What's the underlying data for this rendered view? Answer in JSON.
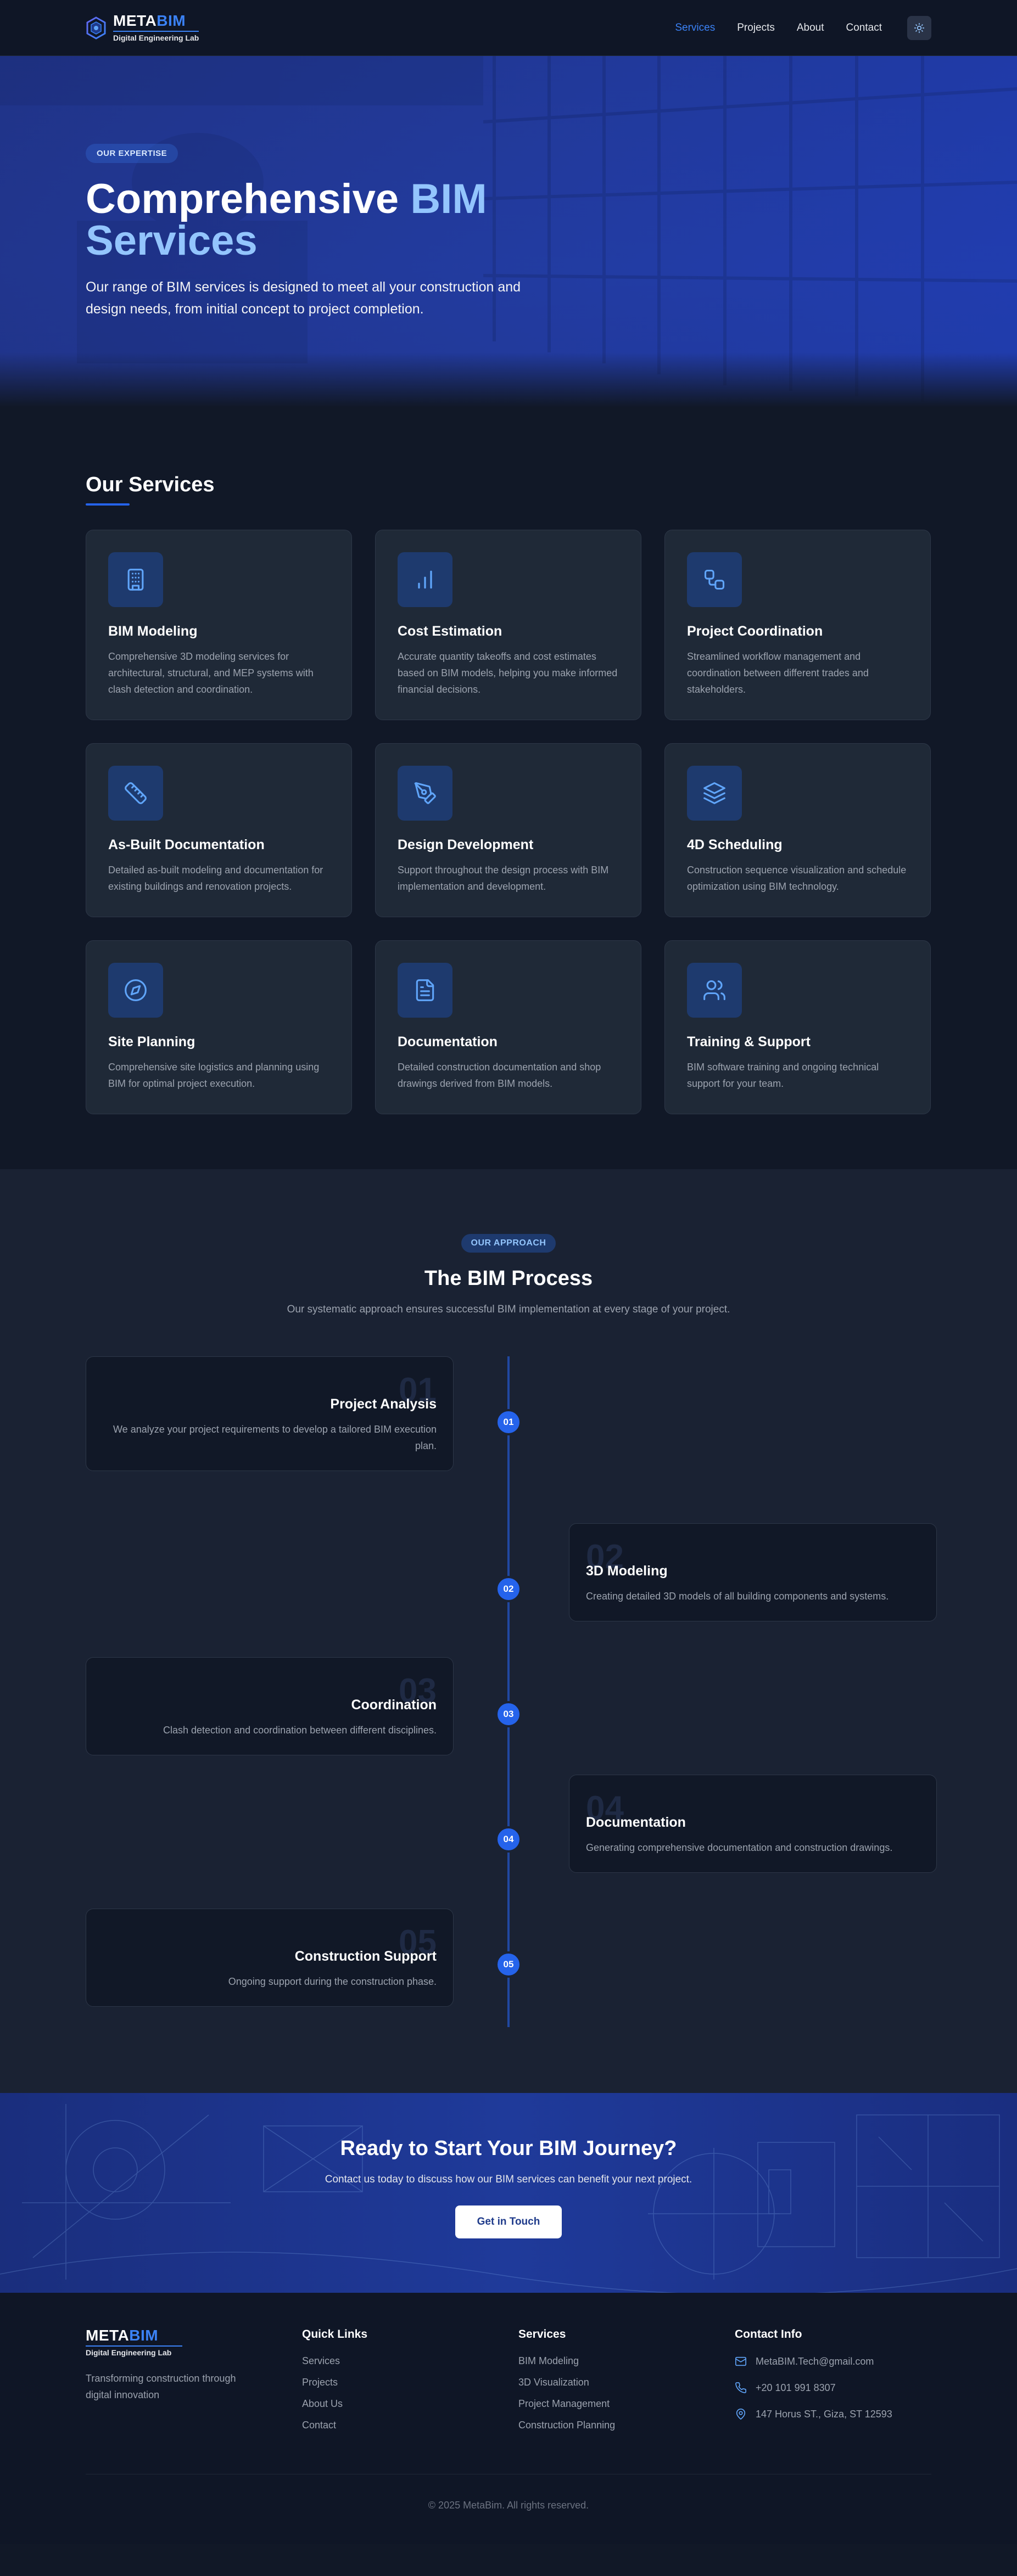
{
  "brand": {
    "name_a": "META",
    "name_b": "BIM",
    "sub": "Digital Engineering Lab",
    "accent": "#3b82f6"
  },
  "nav": {
    "links": [
      "Services",
      "Projects",
      "About",
      "Contact"
    ],
    "active": "Services",
    "theme_icon": "sun-icon"
  },
  "hero": {
    "badge": "OUR EXPERTISE",
    "title_a": "Comprehensive",
    "title_b": "BIM Services",
    "description": "Our range of BIM services is designed to meet all your construction and design needs, from initial concept to project completion."
  },
  "services": {
    "heading": "Our Services",
    "items": [
      {
        "icon": "building-icon",
        "title": "BIM Modeling",
        "desc": "Comprehensive 3D modeling services for architectural, structural, and MEP systems with clash detection and coordination."
      },
      {
        "icon": "bar-chart-icon",
        "title": "Cost Estimation",
        "desc": "Accurate quantity takeoffs and cost estimates based on BIM models, helping you make informed financial decisions."
      },
      {
        "icon": "workflow-icon",
        "title": "Project Coordination",
        "desc": "Streamlined workflow management and coordination between different trades and stakeholders."
      },
      {
        "icon": "ruler-icon",
        "title": "As-Built Documentation",
        "desc": "Detailed as-built modeling and documentation for existing buildings and renovation projects."
      },
      {
        "icon": "pen-tool-icon",
        "title": "Design Development",
        "desc": "Support throughout the design process with BIM implementation and development."
      },
      {
        "icon": "layers-icon",
        "title": "4D Scheduling",
        "desc": "Construction sequence visualization and schedule optimization using BIM technology."
      },
      {
        "icon": "compass-icon",
        "title": "Site Planning",
        "desc": "Comprehensive site logistics and planning using BIM for optimal project execution."
      },
      {
        "icon": "document-icon",
        "title": "Documentation",
        "desc": "Detailed construction documentation and shop drawings derived from BIM models."
      },
      {
        "icon": "users-icon",
        "title": "Training & Support",
        "desc": "BIM software training and ongoing technical support for your team."
      }
    ]
  },
  "process": {
    "badge": "OUR APPROACH",
    "heading": "The BIM Process",
    "subheading": "Our systematic approach ensures successful BIM implementation at every stage of your project.",
    "steps": [
      {
        "num": "01",
        "title": "Project Analysis",
        "desc": "We analyze your project requirements to develop a tailored BIM execution plan.",
        "side": "left"
      },
      {
        "num": "02",
        "title": "3D Modeling",
        "desc": "Creating detailed 3D models of all building components and systems.",
        "side": "right"
      },
      {
        "num": "03",
        "title": "Coordination",
        "desc": "Clash detection and coordination between different disciplines.",
        "side": "left"
      },
      {
        "num": "04",
        "title": "Documentation",
        "desc": "Generating comprehensive documentation and construction drawings.",
        "side": "right"
      },
      {
        "num": "05",
        "title": "Construction Support",
        "desc": "Ongoing support during the construction phase.",
        "side": "left"
      }
    ]
  },
  "cta": {
    "heading": "Ready to Start Your BIM Journey?",
    "sub": "Contact us today to discuss how our BIM services can benefit your next project.",
    "button": "Get in Touch"
  },
  "footer": {
    "tagline": "Transforming construction through digital innovation",
    "quick_links_heading": "Quick Links",
    "quick_links": [
      "Services",
      "Projects",
      "About Us",
      "Contact"
    ],
    "services_heading": "Services",
    "services_links": [
      "BIM Modeling",
      "3D Visualization",
      "Project Management",
      "Construction Planning"
    ],
    "contact_heading": "Contact Info",
    "email": "MetaBIM.Tech@gmail.com",
    "phone": "+20 101 991 8307",
    "address": "147 Horus ST., Giza, ST 12593",
    "copyright": "© 2025 MetaBim. All rights reserved."
  }
}
